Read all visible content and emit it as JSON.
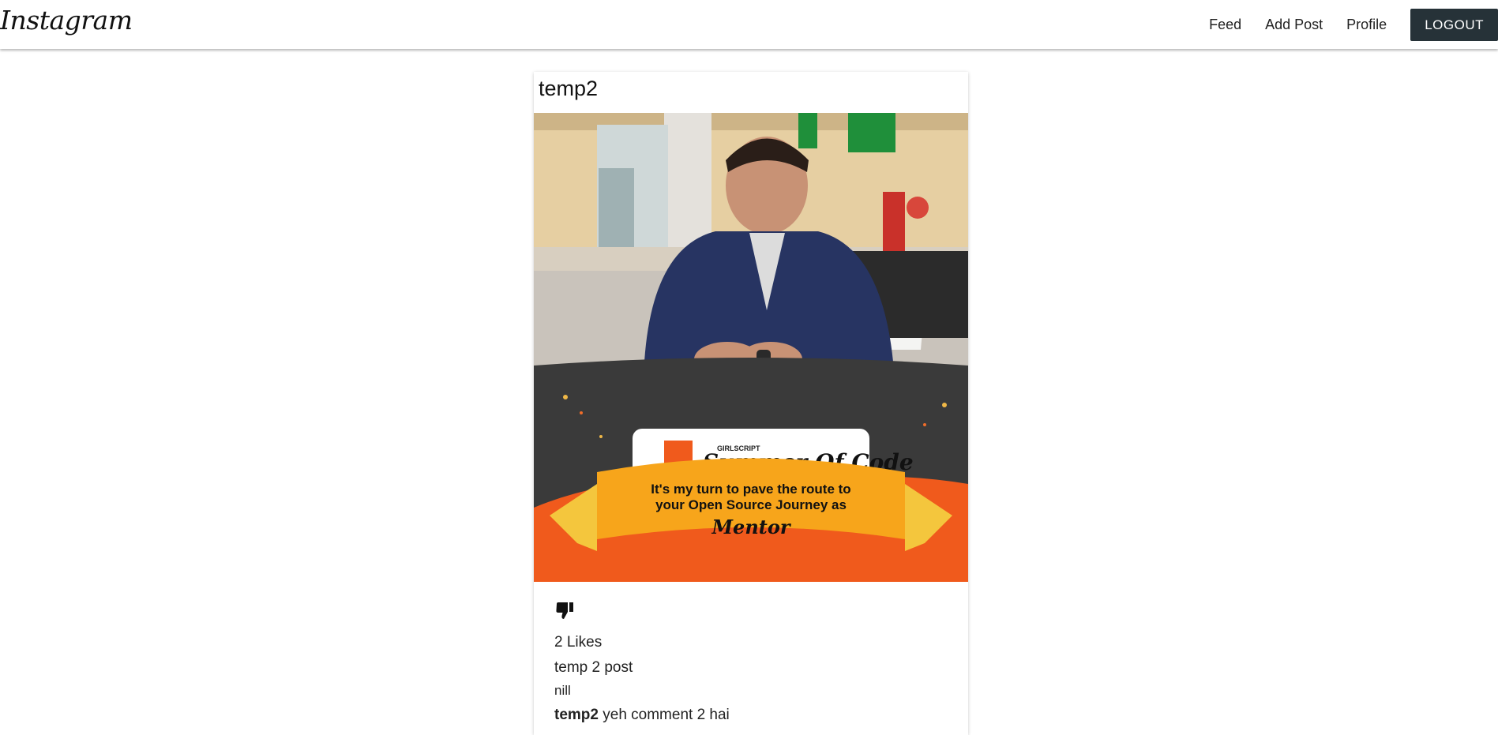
{
  "navbar": {
    "brand": "Instagram",
    "links": [
      "Feed",
      "Add Post",
      "Profile"
    ],
    "logout_label": "LOGOUT"
  },
  "post": {
    "username": "temp2",
    "image_banner": {
      "brand_small": "GIRLSCRIPT",
      "brand_script": "Summer Of Code",
      "ribbon_line1": "It's my turn to pave the route to",
      "ribbon_line2": "your Open Source Journey as",
      "ribbon_role": "Mentor"
    },
    "like_icon": "thumbs-down-icon",
    "likes_text": "2 Likes",
    "title": "temp 2 post",
    "body": "nill",
    "comments": [
      {
        "user": "temp2",
        "text": "yeh comment 2 hai"
      }
    ]
  },
  "colors": {
    "logout_bg": "#263238",
    "banner_orange": "#f05a1c",
    "ribbon_yellow": "#f7a51b"
  }
}
